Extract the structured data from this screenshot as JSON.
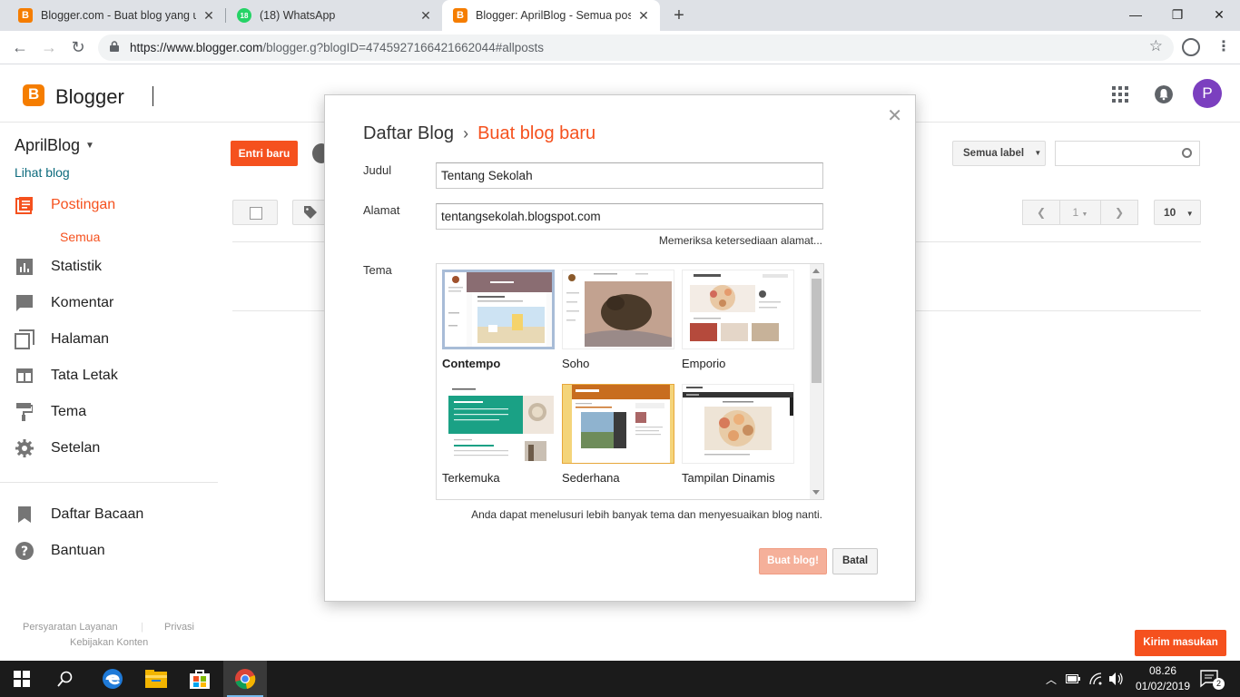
{
  "browser": {
    "tabs": [
      {
        "title": "Blogger.com - Buat blog yang unik",
        "favicon": "blogger-icon",
        "active": false
      },
      {
        "title": "(18) WhatsApp",
        "favicon": "whatsapp-icon",
        "badge": "18",
        "active": false
      },
      {
        "title": "Blogger: AprilBlog - Semua posting",
        "favicon": "blogger-icon",
        "active": true
      }
    ],
    "url_host": "https://www.blogger.com",
    "url_path": "/blogger.g?blogID=4745927166421662044#allposts"
  },
  "header": {
    "app_name": "Blogger",
    "avatar_letter": "P"
  },
  "sidebar": {
    "blog_name": "AprilBlog",
    "view_blog": "Lihat blog",
    "items": [
      {
        "label": "Postingan",
        "icon": "posts-icon",
        "active": true
      },
      {
        "label": "Statistik",
        "icon": "stats-icon"
      },
      {
        "label": "Komentar",
        "icon": "comment-icon"
      },
      {
        "label": "Halaman",
        "icon": "pages-icon"
      },
      {
        "label": "Tata Letak",
        "icon": "layout-icon"
      },
      {
        "label": "Tema",
        "icon": "paint-roller-icon"
      },
      {
        "label": "Setelan",
        "icon": "gear-icon"
      }
    ],
    "sub_item": "Semua",
    "bottom_items": [
      {
        "label": "Daftar Bacaan",
        "icon": "bookmark-icon"
      },
      {
        "label": "Bantuan",
        "icon": "help-icon"
      }
    ],
    "footer": {
      "terms": "Persyaratan Layanan",
      "privacy": "Privasi",
      "content_policy": "Kebijakan Konten"
    }
  },
  "main": {
    "new_post": "Entri baru",
    "label_filter": "Semua label",
    "page_number": "1",
    "per_page": "10",
    "feedback": "Kirim masukan"
  },
  "modal": {
    "breadcrumb_root": "Daftar Blog",
    "breadcrumb_sep": "›",
    "breadcrumb_current": "Buat blog baru",
    "title_label": "Judul",
    "title_value": "Tentang Sekolah",
    "address_label": "Alamat",
    "address_value": "tentangsekolah.blogspot.com",
    "availability": "Memeriksa ketersediaan alamat...",
    "theme_label": "Tema",
    "themes": [
      {
        "name": "Contempo",
        "selected": true
      },
      {
        "name": "Soho"
      },
      {
        "name": "Emporio"
      },
      {
        "name": "Terkemuka"
      },
      {
        "name": "Sederhana"
      },
      {
        "name": "Tampilan Dinamis"
      }
    ],
    "hint": "Anda dapat menelusuri lebih banyak tema dan menyesuaikan blog nanti.",
    "create_button": "Buat blog!",
    "cancel_button": "Batal"
  },
  "taskbar": {
    "time": "08.26",
    "date": "01/02/2019",
    "notifications": "2"
  },
  "colors": {
    "accent": "#f5511e",
    "blogger_orange": "#f57d00",
    "link": "#0d6b7d"
  }
}
